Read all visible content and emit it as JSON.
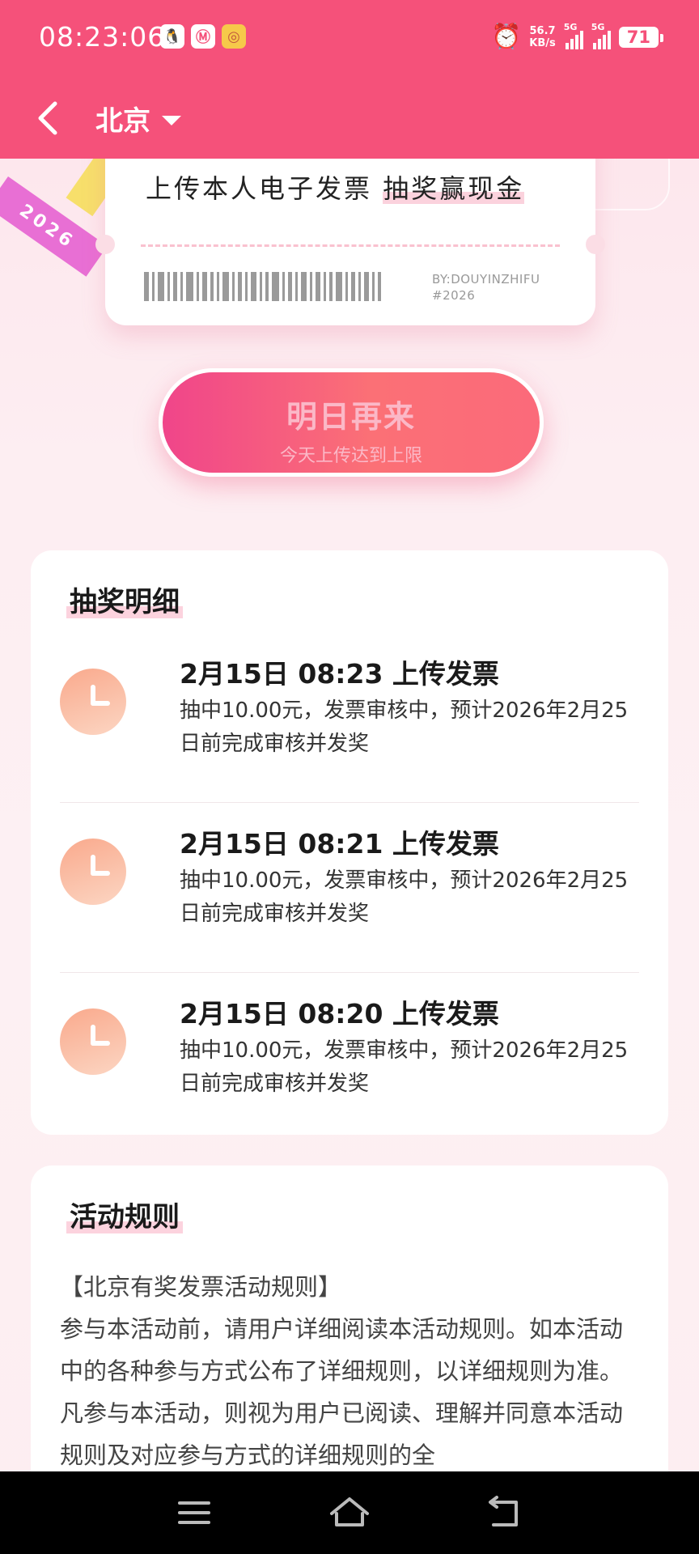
{
  "status_bar": {
    "time": "08:23:06",
    "net_speed_value": "56.7",
    "net_speed_unit": "KB/s",
    "signal1_label": "5G",
    "signal2_label": "5G",
    "battery": "71"
  },
  "header": {
    "city": "北京",
    "bg_color": "#f5517a"
  },
  "ticket": {
    "ribbon_text": "2026",
    "headline_prefix": "上传本人电子发票 ",
    "headline_highlight": "抽奖赢现金",
    "by_line1": "BY:DOUYINZHIFU",
    "by_line2": "#2026"
  },
  "cta": {
    "main_label": "明日再来",
    "sub_label": "今天上传达到上限"
  },
  "lottery": {
    "title": "抽奖明细",
    "records": [
      {
        "title": "2月15日 08:23 上传发票",
        "desc": "抽中10.00元，发票审核中，预计2026年2月25日前完成审核并发奖"
      },
      {
        "title": "2月15日 08:21 上传发票",
        "desc": "抽中10.00元，发票审核中，预计2026年2月25日前完成审核并发奖"
      },
      {
        "title": "2月15日 08:20 上传发票",
        "desc": "抽中10.00元，发票审核中，预计2026年2月25日前完成审核并发奖"
      }
    ]
  },
  "rules": {
    "title": "活动规则",
    "heading": "【北京有奖发票活动规则】",
    "body": "参与本活动前，请用户详细阅读本活动规则。如本活动中的各种参与方式公布了详细规则，以详细规则为准。凡参与本活动，则视为用户已阅读、理解并同意本活动规则及对应参与方式的详细规则的全"
  }
}
